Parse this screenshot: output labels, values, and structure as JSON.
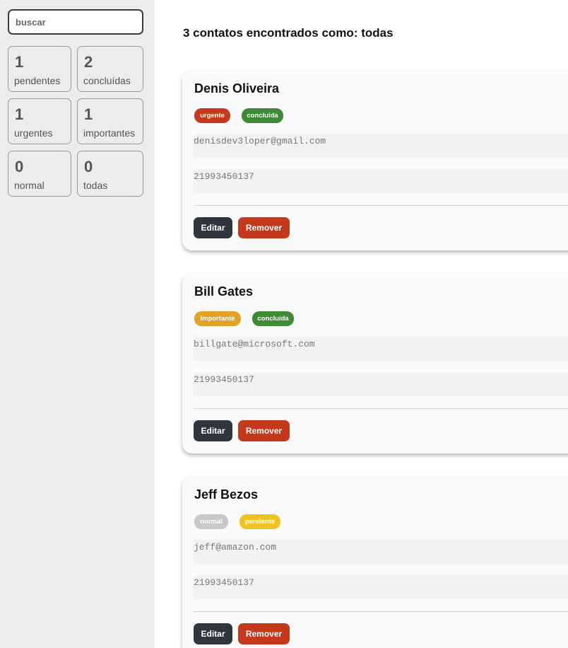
{
  "search": {
    "placeholder": "buscar"
  },
  "filters": [
    {
      "count": "1",
      "label": "pendentes"
    },
    {
      "count": "2",
      "label": "concluídas"
    },
    {
      "count": "1",
      "label": "urgentes"
    },
    {
      "count": "1",
      "label": "importantes"
    },
    {
      "count": "0",
      "label": "normal"
    },
    {
      "count": "0",
      "label": "todas"
    }
  ],
  "heading": "3 contatos encontrados como: todas",
  "contacts": [
    {
      "name": "Denis Oliveira",
      "tags": [
        {
          "label": "urgente",
          "color": "#c4391b"
        },
        {
          "label": "concluída",
          "color": "#3f8a35"
        }
      ],
      "email": "denisdev3loper@gmail.com",
      "phone": "21993450137"
    },
    {
      "name": "Bill Gates",
      "tags": [
        {
          "label": "importante",
          "color": "#e0a229"
        },
        {
          "label": "concluída",
          "color": "#3f8a35"
        }
      ],
      "email": "billgate@microsoft.com",
      "phone": "21993450137"
    },
    {
      "name": "Jeff Bezos",
      "tags": [
        {
          "label": "normal",
          "color": "#c8c8c8"
        },
        {
          "label": "pendente",
          "color": "#eec321"
        }
      ],
      "email": "jeff@amazon.com",
      "phone": "21993450137"
    }
  ],
  "actions": {
    "edit": "Editar",
    "remove": "Remover"
  }
}
